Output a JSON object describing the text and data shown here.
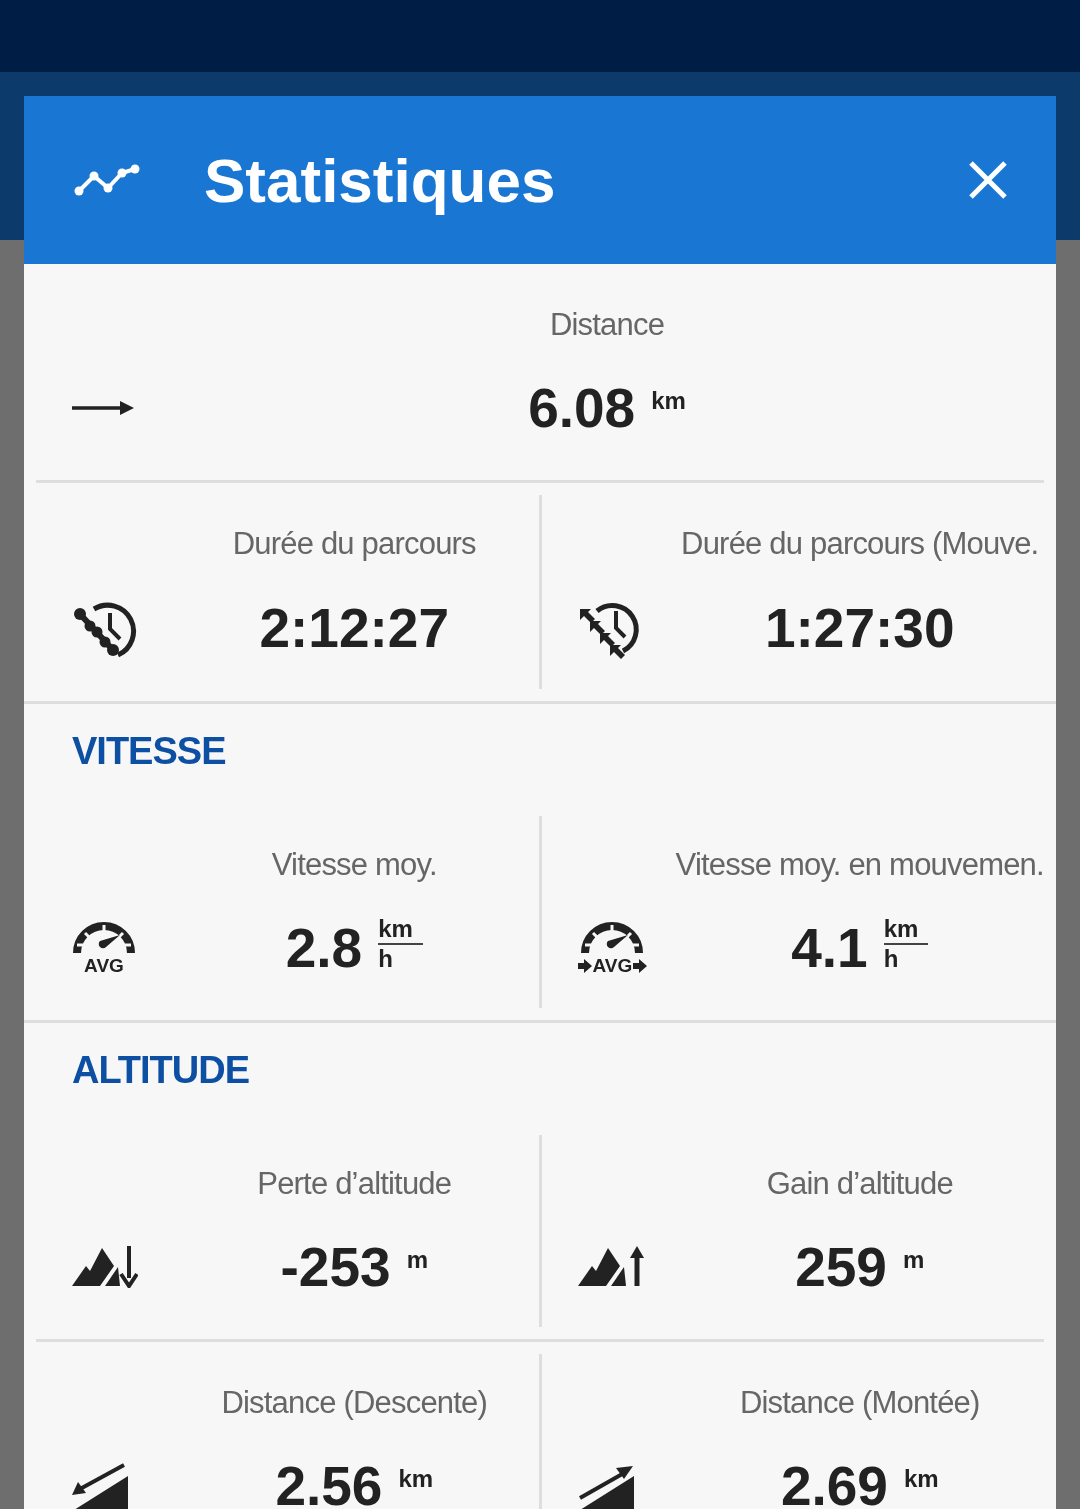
{
  "header": {
    "title": "Statistiques"
  },
  "sections": [
    {
      "rows": [
        {
          "stats": [
            {
              "kind": "arrow",
              "label": "Distance",
              "value": "6.08",
              "unit": "km"
            }
          ]
        },
        {
          "stats": [
            {
              "kind": "clock-chain",
              "label": "Durée du parcours",
              "value": "2:12:27"
            },
            {
              "kind": "clock-arrows",
              "label": "Durée du parcours (Mouve.",
              "value": "1:27:30"
            }
          ]
        }
      ]
    },
    {
      "title": "VITESSE",
      "rows": [
        {
          "stats": [
            {
              "kind": "gauge",
              "icon_text": "AVG",
              "label": "Vitesse moy.",
              "value": "2.8",
              "unit_fraction": {
                "top": "km",
                "bottom": "h"
              }
            },
            {
              "kind": "gauge-arrows",
              "icon_text": "AVG",
              "label": "Vitesse moy. en mouvemen.",
              "value": "4.1",
              "unit_fraction": {
                "top": "km",
                "bottom": "h"
              }
            }
          ]
        }
      ]
    },
    {
      "title": "ALTITUDE",
      "rows": [
        {
          "stats": [
            {
              "kind": "mountain-down",
              "label": "Perte d’altitude",
              "value": "-253",
              "unit": "m"
            },
            {
              "kind": "mountain-up",
              "label": "Gain d’altitude",
              "value": "259",
              "unit": "m"
            }
          ]
        },
        {
          "stats": [
            {
              "kind": "slope-down",
              "label": "Distance (Descente)",
              "value": "2.56",
              "unit": "km"
            },
            {
              "kind": "slope-up",
              "label": "Distance (Montée)",
              "value": "2.69",
              "unit": "km"
            }
          ]
        }
      ]
    }
  ]
}
